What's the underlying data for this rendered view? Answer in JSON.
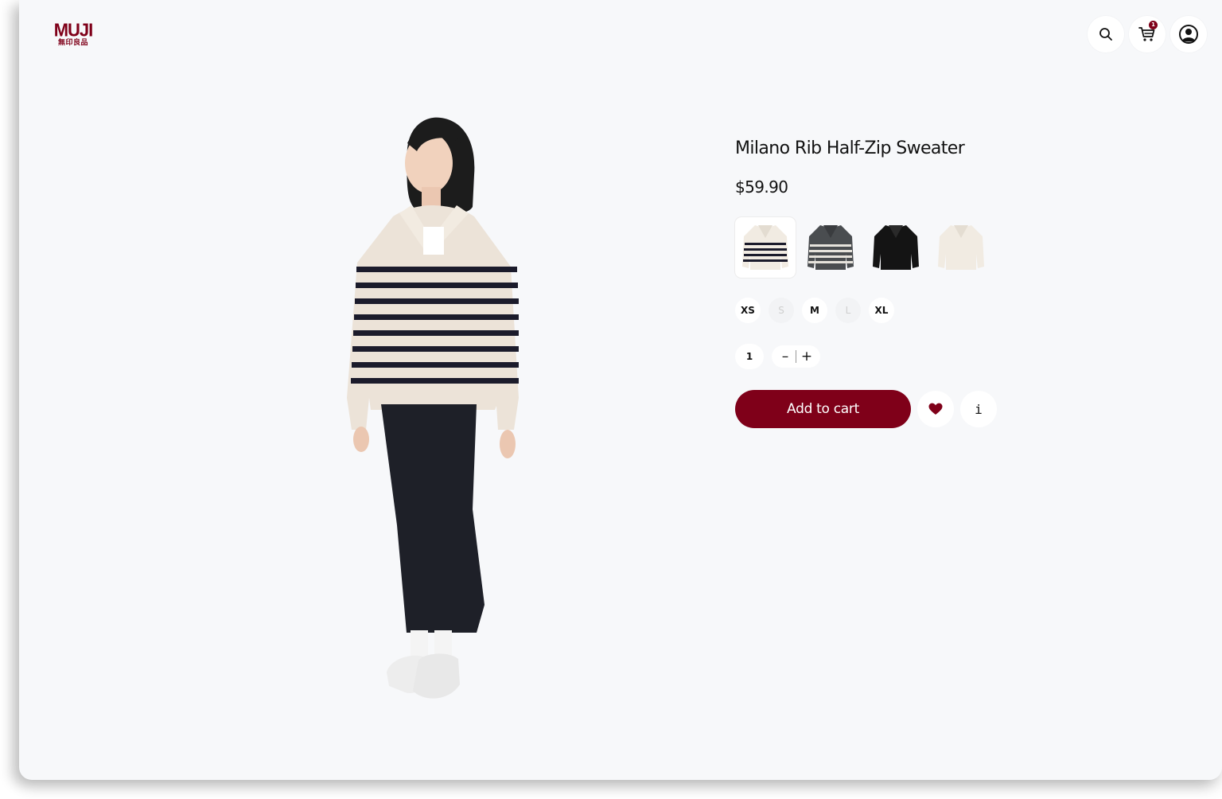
{
  "header": {
    "logo_text": "MUJI",
    "logo_subtext": "無印良品",
    "cart_count": "1"
  },
  "product": {
    "title": "Milano Rib Half-Zip Sweater",
    "price": "$59.90",
    "swatches": [
      {
        "name": "ecru-navy-stripe",
        "selected": true
      },
      {
        "name": "gray-stripe",
        "selected": false
      },
      {
        "name": "black",
        "selected": false
      },
      {
        "name": "off-white",
        "selected": false
      }
    ],
    "sizes": [
      {
        "label": "XS",
        "available": true
      },
      {
        "label": "S",
        "available": false
      },
      {
        "label": "M",
        "available": true
      },
      {
        "label": "L",
        "available": false
      },
      {
        "label": "XL",
        "available": true
      }
    ],
    "quantity": "1",
    "decrement_symbol": "–",
    "increment_symbol": "+",
    "add_to_cart_label": "Add to cart",
    "info_symbol": "i"
  },
  "colors": {
    "brand": "#7f0019",
    "page_background": "#f7f8fa"
  },
  "icons": [
    "search-icon",
    "cart-icon",
    "user-icon",
    "heart-icon",
    "info-icon"
  ]
}
